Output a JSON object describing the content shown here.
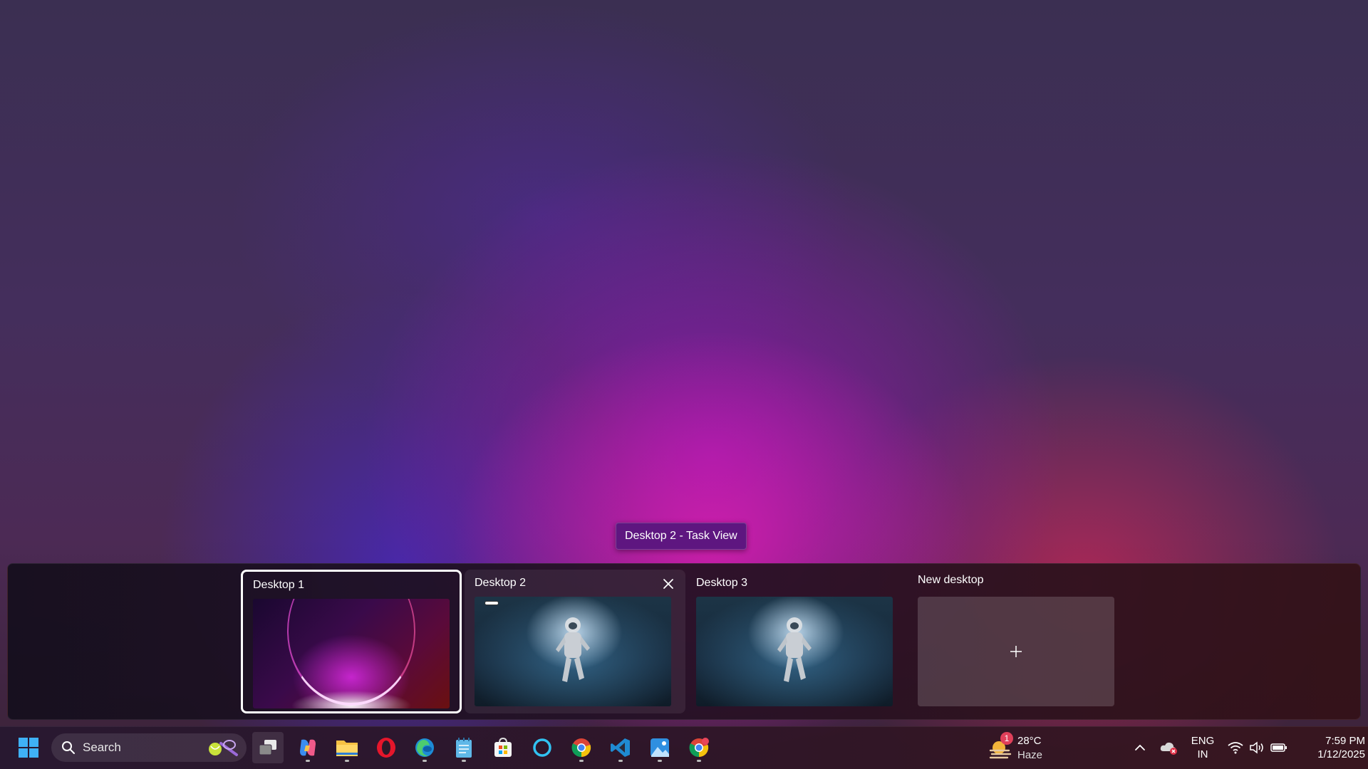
{
  "tooltip": "Desktop 2 - Task View",
  "task_view": {
    "desktops": [
      {
        "label": "Desktop 1",
        "wallpaper": "abstract-purple-glow",
        "active": true
      },
      {
        "label": "Desktop 2",
        "wallpaper": "astronaut-space",
        "active": false
      },
      {
        "label": "Desktop 3",
        "wallpaper": "astronaut-space",
        "active": false
      }
    ],
    "new_desktop_label": "New desktop",
    "new_desktop_icon": "plus-icon"
  },
  "taskbar": {
    "search_placeholder": "Search",
    "apps": [
      {
        "name": "start-button",
        "icon": "windows-logo-icon"
      },
      {
        "name": "task-view-button",
        "icon": "task-view-icon"
      },
      {
        "name": "copilot-app",
        "icon": "copilot-icon"
      },
      {
        "name": "file-explorer-app",
        "icon": "folder-icon"
      },
      {
        "name": "opera-app",
        "icon": "opera-icon"
      },
      {
        "name": "edge-app",
        "icon": "edge-icon"
      },
      {
        "name": "notepad-app",
        "icon": "notepad-icon"
      },
      {
        "name": "microsoft-store-app",
        "icon": "store-icon"
      },
      {
        "name": "cortana-app",
        "icon": "ring-icon"
      },
      {
        "name": "chrome-app",
        "icon": "chrome-icon"
      },
      {
        "name": "vscode-app",
        "icon": "vscode-icon"
      },
      {
        "name": "photos-app",
        "icon": "photos-icon"
      },
      {
        "name": "chrome-profile-app",
        "icon": "chrome-icon"
      }
    ],
    "weather": {
      "temp": "28°C",
      "condition": "Haze",
      "badge": "1"
    },
    "tray": {
      "lang_line1": "ENG",
      "lang_line2": "IN",
      "time": "7:59 PM",
      "date": "1/12/2025"
    }
  }
}
